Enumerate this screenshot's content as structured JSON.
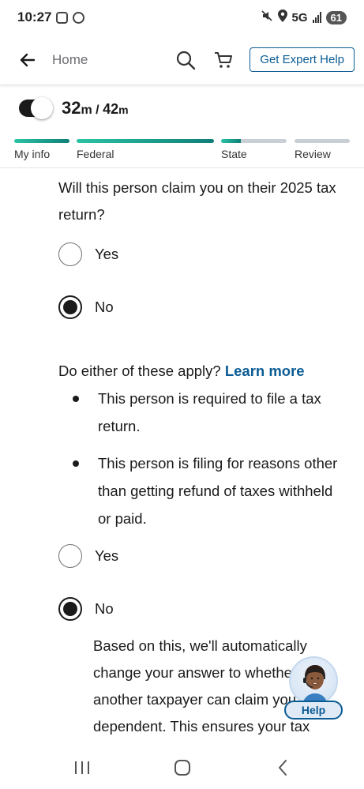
{
  "status_bar": {
    "time": "10:27",
    "network": "5G",
    "battery": "61"
  },
  "header": {
    "back_icon": "arrow-left-icon",
    "home_label": "Home",
    "search_icon": "search-icon",
    "cart_icon": "cart-icon",
    "expert_help_label": "Get Expert Help"
  },
  "timer": {
    "elapsed": "32",
    "elapsed_unit": "m",
    "separator": " / ",
    "total": "42",
    "total_unit": "m"
  },
  "progress_steps": [
    {
      "label": "My info",
      "progress": 1.0
    },
    {
      "label": "Federal",
      "progress": 1.0
    },
    {
      "label": "State",
      "progress": 0.3
    },
    {
      "label": "Review",
      "progress": 0.0
    }
  ],
  "question1": {
    "text": "Will this person claim you on their 2025 tax return?",
    "options": [
      {
        "label": "Yes",
        "selected": false
      },
      {
        "label": "No",
        "selected": true
      }
    ]
  },
  "question2": {
    "text": "Do either of these apply?",
    "link": "Learn more",
    "bullets": [
      "This person is required to file a tax return.",
      "This person is filing for reasons other than getting refund of taxes withheld or paid."
    ],
    "options": [
      {
        "label": "Yes",
        "selected": false
      },
      {
        "label": "No",
        "selected": true
      }
    ],
    "note": "Based on this, we'll automatically change your answer to whether another taxpayer can claim you as a dependent. This ensures your tax"
  },
  "help_widget": {
    "label": "Help",
    "icon": "agent-avatar-icon"
  },
  "nav_bar": {
    "recents_icon": "recents-icon",
    "home_icon": "home-circle-icon",
    "back_icon": "chevron-left-icon"
  },
  "colors": {
    "accent": "#0b5b94",
    "progress_start": "#2bc3a3",
    "progress_end": "#0f7f79",
    "track": "#c9cfd4"
  }
}
